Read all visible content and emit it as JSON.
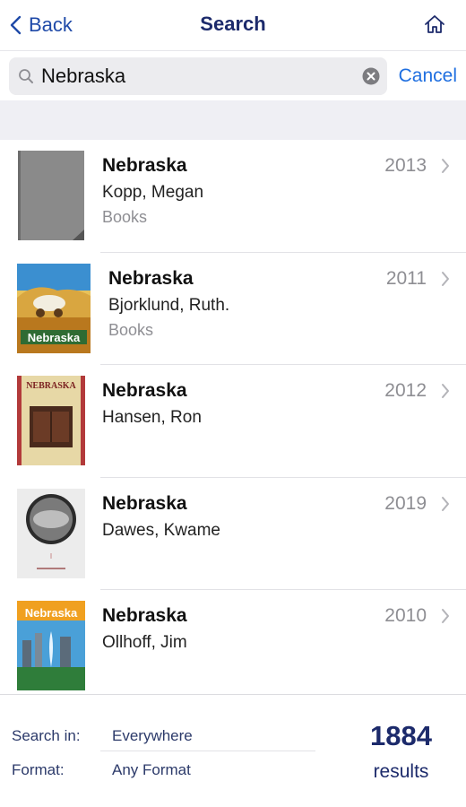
{
  "nav": {
    "back_label": "Back",
    "title": "Search",
    "home_icon": "home-icon"
  },
  "search": {
    "query": "Nebraska",
    "cancel_label": "Cancel"
  },
  "results": [
    {
      "title": "Nebraska",
      "author": "Kopp, Megan",
      "format": "Books",
      "year": "2013",
      "cover": "plain-gray-cover"
    },
    {
      "title": "Nebraska",
      "author": "Bjorklund, Ruth.",
      "format": "Books",
      "year": "2011",
      "cover": "covered-wagon-cover"
    },
    {
      "title": "Nebraska",
      "author": "Hansen, Ron",
      "format": "",
      "year": "2012",
      "cover": "nebraska-stories-cover"
    },
    {
      "title": "Nebraska",
      "author": "Dawes, Kwame",
      "format": "",
      "year": "2019",
      "cover": "gray-circle-cover"
    },
    {
      "title": "Nebraska",
      "author": "Ollhoff, Jim",
      "format": "",
      "year": "2010",
      "cover": "city-fountain-cover"
    }
  ],
  "footer": {
    "search_in_label": "Search in:",
    "search_in_value": "Everywhere",
    "format_label": "Format:",
    "format_value": "Any Format",
    "count": "1884",
    "count_label": "results"
  },
  "colors": {
    "nav_title": "#1c2a6b",
    "link_blue": "#1f6fe0",
    "back_blue": "#1f4aa8",
    "band_gray": "#efeff4"
  }
}
